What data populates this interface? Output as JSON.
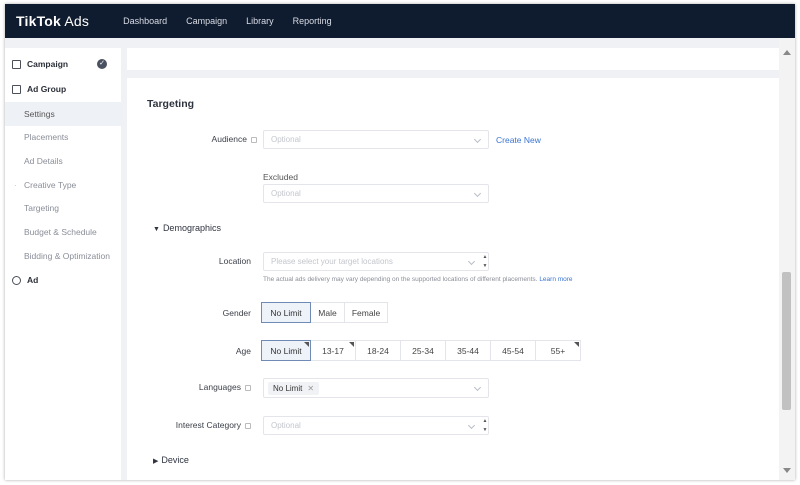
{
  "header": {
    "brand_main": "TikTok",
    "brand_sub": " Ads",
    "nav": [
      "Dashboard",
      "Campaign",
      "Library",
      "Reporting"
    ]
  },
  "sidebar": {
    "campaign": "Campaign",
    "ad_group": "Ad Group",
    "items": [
      "Settings",
      "Placements",
      "Ad Details",
      "Creative Type",
      "Targeting",
      "Budget & Schedule",
      "Bidding & Optimization"
    ],
    "ad": "Ad"
  },
  "targeting": {
    "title": "Targeting",
    "audience_label": "Audience",
    "audience_placeholder": "Optional",
    "create_new": "Create New",
    "excluded_label": "Excluded",
    "excluded_placeholder": "Optional",
    "demographics": "Demographics",
    "location_label": "Location",
    "location_placeholder": "Please select your target locations",
    "location_note": "The actual ads delivery may vary depending on the supported locations of different placements.",
    "learn_more": "Learn more",
    "gender_label": "Gender",
    "gender_options": [
      "No Limit",
      "Male",
      "Female"
    ],
    "age_label": "Age",
    "age_options": [
      "No Limit",
      "13-17",
      "18-24",
      "25-34",
      "35-44",
      "45-54",
      "55+"
    ],
    "languages_label": "Languages",
    "languages_tag": "No Limit",
    "interest_label": "Interest Category",
    "interest_placeholder": "Optional",
    "device": "Device"
  }
}
